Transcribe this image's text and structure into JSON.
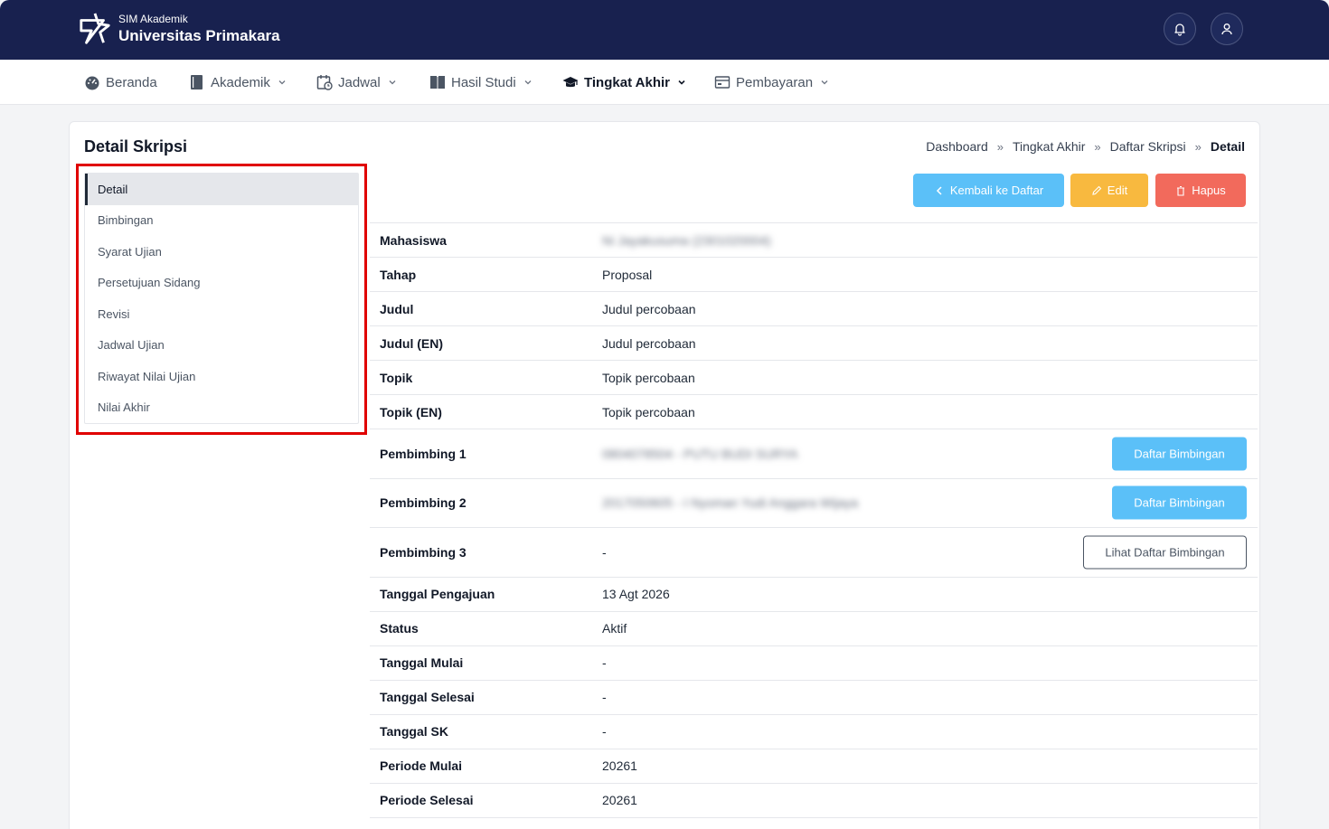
{
  "header": {
    "app_small": "SIM Akademik",
    "app_name": "Universitas Primakara"
  },
  "nav": [
    {
      "label": "Beranda",
      "icon": "dashboard-icon"
    },
    {
      "label": "Akademik",
      "icon": "book-icon"
    },
    {
      "label": "Jadwal",
      "icon": "calendar-icon"
    },
    {
      "label": "Hasil Studi",
      "icon": "open-book-icon"
    },
    {
      "label": "Tingkat Akhir",
      "icon": "graduation-cap-icon"
    },
    {
      "label": "Pembayaran",
      "icon": "wallet-icon"
    }
  ],
  "page": {
    "title": "Detail Skripsi",
    "breadcrumb": [
      "Dashboard",
      "Tingkat Akhir",
      "Daftar Skripsi",
      "Detail"
    ]
  },
  "side_menu": [
    "Detail",
    "Bimbingan",
    "Syarat Ujian",
    "Persetujuan Sidang",
    "Revisi",
    "Jadwal Ujian",
    "Riwayat Nilai Ujian",
    "Nilai Akhir"
  ],
  "actions": {
    "back": "Kembali ke Daftar",
    "edit": "Edit",
    "delete": "Hapus"
  },
  "details": {
    "mahasiswa": {
      "label": "Mahasiswa",
      "value": "Ni Jayakusuma (2301020004)"
    },
    "tahap": {
      "label": "Tahap",
      "value": "Proposal"
    },
    "judul": {
      "label": "Judul",
      "value": "Judul percobaan"
    },
    "judul_en": {
      "label": "Judul (EN)",
      "value": "Judul percobaan"
    },
    "topik": {
      "label": "Topik",
      "value": "Topik percobaan"
    },
    "topik_en": {
      "label": "Topik (EN)",
      "value": "Topik percobaan"
    },
    "pembimbing1": {
      "label": "Pembimbing 1",
      "value": "0804078504 - PUTU BUDI SURYA",
      "button": "Daftar Bimbingan"
    },
    "pembimbing2": {
      "label": "Pembimbing 2",
      "value": "2017050605 - I Nyoman Yudi Anggara Wijaya",
      "button": "Daftar Bimbingan"
    },
    "pembimbing3": {
      "label": "Pembimbing 3",
      "value": "-",
      "button": "Lihat Daftar Bimbingan"
    },
    "tanggal_pengajuan": {
      "label": "Tanggal Pengajuan",
      "value": "13 Agt 2026"
    },
    "status": {
      "label": "Status",
      "value": "Aktif"
    },
    "tanggal_mulai": {
      "label": "Tanggal Mulai",
      "value": "-"
    },
    "tanggal_selesai": {
      "label": "Tanggal Selesai",
      "value": "-"
    },
    "tanggal_sk": {
      "label": "Tanggal SK",
      "value": "-"
    },
    "periode_mulai": {
      "label": "Periode Mulai",
      "value": "20261"
    },
    "periode_selesai": {
      "label": "Periode Selesai",
      "value": "20261"
    }
  },
  "colors": {
    "header_bg": "#18214f",
    "info": "#5bc0f8",
    "warning": "#f8b93f",
    "danger": "#f26a5c",
    "highlight": "#e00000"
  }
}
